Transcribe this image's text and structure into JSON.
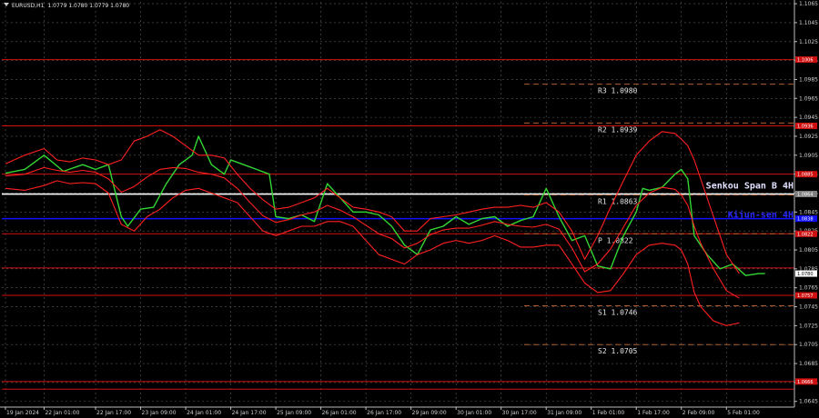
{
  "chart_data": {
    "type": "line",
    "title": "EURUSD,H1",
    "ohlc_text": "1.0779 1.0780 1.0779 1.0780",
    "ylim": [
      1.0639,
      1.1067
    ],
    "xlim": [
      0,
      100
    ],
    "grid": true,
    "y_ticks": [
      "1.1065",
      "1.1045",
      "1.1025",
      "1.1005",
      "1.0985",
      "1.0965",
      "1.0945",
      "1.0925",
      "1.0905",
      "1.0885",
      "1.0865",
      "1.0845",
      "1.0825",
      "1.0805",
      "1.0785",
      "1.0765",
      "1.0745",
      "1.0725",
      "1.0705",
      "1.0685",
      "1.0665",
      "1.0645"
    ],
    "x_ticks": [
      {
        "t": 0,
        "label": "19 Jan 2024"
      },
      {
        "t": 6,
        "label": "22 Jan 01:00"
      },
      {
        "t": 14,
        "label": "22 Jan 17:00"
      },
      {
        "t": 21,
        "label": "23 Jan 09:00"
      },
      {
        "t": 28,
        "label": "24 Jan 01:00"
      },
      {
        "t": 35,
        "label": "24 Jan 17:00"
      },
      {
        "t": 42,
        "label": "25 Jan 09:00"
      },
      {
        "t": 49,
        "label": "26 Jan 01:00"
      },
      {
        "t": 56,
        "label": "26 Jan 17:00"
      },
      {
        "t": 63,
        "label": "29 Jan 09:00"
      },
      {
        "t": 70,
        "label": "30 Jan 01:00"
      },
      {
        "t": 77,
        "label": "30 Jan 17:00"
      },
      {
        "t": 84,
        "label": "31 Jan 09:00"
      },
      {
        "t": 91,
        "label": "1 Feb 01:00"
      },
      {
        "t": 98,
        "label": "1 Feb 17:00"
      },
      {
        "t": 105,
        "label": "2 Feb 09:00"
      },
      {
        "t": 112,
        "label": "5 Feb 01:00"
      }
    ],
    "levels": [
      {
        "value": 1.1006,
        "color": "#d01010",
        "box_label": "1.1006"
      },
      {
        "value": 1.0936,
        "color": "#d01010",
        "box_label": "1.0936"
      },
      {
        "value": 1.0885,
        "color": "#d01010",
        "box_label": "1.0885"
      },
      {
        "value": 1.0864,
        "color": "#ffffff",
        "box_label": "1.0864"
      },
      {
        "value": 1.0838,
        "color": "#1010ff",
        "box_label": "1.0838"
      },
      {
        "value": 1.0822,
        "color": "#d01010",
        "box_label": "1.0822"
      },
      {
        "value": 1.0786,
        "color": "#d01010",
        "box_label": ""
      },
      {
        "value": 1.0757,
        "color": "#d01010",
        "box_label": "1.0757"
      },
      {
        "value": 1.0666,
        "color": "#d01010",
        "box_label": "1.0666"
      },
      {
        "value": 1.0658,
        "color": "#d01010",
        "box_label": ""
      }
    ],
    "pivots": [
      {
        "label": "R3",
        "value": "1.0980"
      },
      {
        "label": "R2",
        "value": "1.0939"
      },
      {
        "label": "R1",
        "value": "1.0863"
      },
      {
        "label": "P",
        "value": "1.0822"
      },
      {
        "label": "S1",
        "value": "1.0746"
      },
      {
        "label": "S2",
        "value": "1.0705"
      }
    ],
    "indicator_labels": [
      {
        "text": "Senkou Span B 4H",
        "color": "#e0e0ff"
      },
      {
        "text": "Kijun-sen 4H",
        "color": "#2a2aff"
      }
    ],
    "series": [
      {
        "color": "#33d633",
        "x": [
          0,
          3,
          6,
          9,
          12,
          14,
          16,
          18,
          19,
          21,
          23,
          25,
          27,
          29,
          30,
          32,
          34,
          35,
          37,
          39,
          41,
          42,
          44,
          46,
          48,
          50,
          52,
          54,
          56,
          58,
          60,
          62,
          64,
          66,
          68,
          70,
          72,
          74,
          76,
          78,
          80,
          82,
          84,
          86,
          88,
          90,
          92,
          94,
          96,
          98,
          99,
          100,
          102,
          104,
          105,
          106,
          107,
          109,
          111,
          113,
          115,
          117,
          118
        ],
        "y": [
          1.0886,
          1.089,
          1.0905,
          1.0888,
          1.0895,
          1.089,
          1.0895,
          1.084,
          1.083,
          1.0848,
          1.085,
          1.0875,
          1.0895,
          1.0905,
          1.0925,
          1.0895,
          1.0885,
          1.09,
          1.0895,
          1.089,
          1.0885,
          1.084,
          1.0838,
          1.0842,
          1.0835,
          1.0875,
          1.086,
          1.0845,
          1.0845,
          1.0842,
          1.083,
          1.081,
          1.08,
          1.0826,
          1.083,
          1.084,
          1.0832,
          1.0838,
          1.084,
          1.083,
          1.0836,
          1.084,
          1.087,
          1.084,
          1.0815,
          1.082,
          1.0788,
          1.0785,
          1.082,
          1.0845,
          1.087,
          1.0868,
          1.0871,
          1.0885,
          1.089,
          1.088,
          1.082,
          1.08,
          1.0785,
          1.079,
          1.0778,
          1.078,
          1.078
        ]
      },
      {
        "color": "#ff2020",
        "x": [
          0,
          3,
          6,
          8,
          10,
          12,
          14,
          16,
          18,
          20,
          22,
          24,
          26,
          28,
          30,
          32,
          34,
          36,
          38,
          40,
          42,
          44,
          46,
          48,
          50,
          52,
          54,
          56,
          58,
          60,
          62,
          64,
          66,
          68,
          70,
          72,
          74,
          76,
          78,
          80,
          82,
          84,
          86,
          88,
          90,
          92,
          94,
          96,
          98,
          100,
          102,
          104,
          105,
          106,
          107,
          108,
          110,
          112,
          114
        ],
        "y": [
          1.0896,
          1.0905,
          1.0912,
          1.09,
          1.0898,
          1.0902,
          1.09,
          1.0895,
          1.09,
          1.092,
          1.0925,
          1.0932,
          1.0925,
          1.0915,
          1.0905,
          1.0905,
          1.0902,
          1.0885,
          1.087,
          1.0858,
          1.0848,
          1.085,
          1.0855,
          1.086,
          1.087,
          1.086,
          1.085,
          1.0848,
          1.0845,
          1.084,
          1.0825,
          1.0825,
          1.0838,
          1.084,
          1.0842,
          1.0845,
          1.0848,
          1.085,
          1.085,
          1.0852,
          1.085,
          1.0855,
          1.0845,
          1.0825,
          1.0795,
          1.082,
          1.085,
          1.0878,
          1.0905,
          1.092,
          1.093,
          1.0928,
          1.0922,
          1.0915,
          1.09,
          1.088,
          1.084,
          1.08,
          1.078
        ]
      },
      {
        "color": "#ff2020",
        "x": [
          0,
          3,
          6,
          8,
          10,
          12,
          14,
          16,
          18,
          20,
          22,
          24,
          26,
          28,
          30,
          32,
          34,
          36,
          38,
          40,
          42,
          44,
          46,
          48,
          50,
          52,
          54,
          56,
          58,
          60,
          62,
          64,
          66,
          68,
          70,
          72,
          74,
          76,
          78,
          80,
          82,
          84,
          86,
          88,
          90,
          92,
          94,
          96,
          98,
          100,
          102,
          104,
          105,
          106,
          107,
          108,
          110,
          112,
          114
        ],
        "y": [
          1.087,
          1.0868,
          1.0873,
          1.0878,
          1.0875,
          1.0876,
          1.0875,
          1.0865,
          1.0832,
          1.0825,
          1.084,
          1.0848,
          1.086,
          1.0868,
          1.087,
          1.0865,
          1.086,
          1.0855,
          1.084,
          1.0825,
          1.082,
          1.0825,
          1.083,
          1.083,
          1.0835,
          1.0835,
          1.083,
          1.0815,
          1.08,
          1.0795,
          1.079,
          1.08,
          1.0805,
          1.0812,
          1.0815,
          1.0812,
          1.0815,
          1.082,
          1.0815,
          1.0808,
          1.0808,
          1.081,
          1.081,
          1.079,
          1.077,
          1.076,
          1.0762,
          1.078,
          1.08,
          1.081,
          1.0812,
          1.081,
          1.0805,
          1.079,
          1.076,
          1.0745,
          1.073,
          1.0725,
          1.0728
        ]
      },
      {
        "color": "#ff2020",
        "x": [
          0,
          3,
          6,
          8,
          10,
          12,
          14,
          16,
          18,
          20,
          22,
          24,
          26,
          28,
          30,
          32,
          34,
          36,
          38,
          40,
          42,
          44,
          46,
          48,
          50,
          52,
          54,
          56,
          58,
          60,
          62,
          64,
          66,
          68,
          70,
          72,
          74,
          76,
          78,
          80,
          82,
          84,
          86,
          88,
          90,
          92,
          94,
          96,
          98,
          100,
          102,
          104,
          105,
          106,
          107,
          108,
          110,
          112,
          114
        ],
        "y": [
          1.0883,
          1.0885,
          1.0892,
          1.0889,
          1.0887,
          1.0889,
          1.0887,
          1.088,
          1.0866,
          1.0872,
          1.0882,
          1.089,
          1.0892,
          1.0891,
          1.0887,
          1.0885,
          1.0881,
          1.087,
          1.0855,
          1.0841,
          1.0834,
          1.0837,
          1.0842,
          1.0845,
          1.0852,
          1.0847,
          1.084,
          1.0831,
          1.0822,
          1.0817,
          1.0807,
          1.0812,
          1.0821,
          1.0826,
          1.0828,
          1.0828,
          1.0831,
          1.0835,
          1.0832,
          1.083,
          1.0829,
          1.0832,
          1.0827,
          1.0807,
          1.0782,
          1.079,
          1.0806,
          1.0829,
          1.0852,
          1.0865,
          1.0871,
          1.0869,
          1.0863,
          1.0852,
          1.083,
          1.0812,
          1.0785,
          1.0762,
          1.0754
        ]
      }
    ]
  }
}
